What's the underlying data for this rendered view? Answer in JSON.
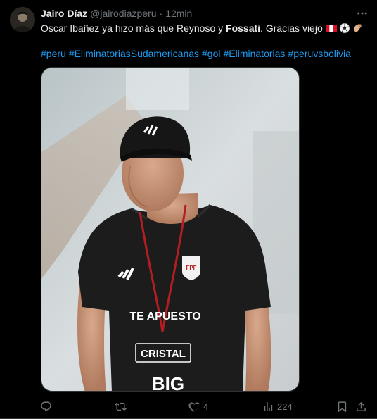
{
  "author": {
    "name": "Jairo Díaz",
    "handle": "@jairodiazperu",
    "separator": "·",
    "time": "12min"
  },
  "tweet": {
    "text_part1": "Oscar Ibañez ya hizo más que Reynoso y ",
    "text_bold": "Fossati",
    "text_part2": ". Gracias viejo",
    "emojis": [
      "peru-flag-icon",
      "soccer-ball-icon",
      "clapping-hands-icon"
    ],
    "hashtags": [
      "#peru",
      "#EliminatoriasSudamericanas",
      "#gol",
      "#Eliminatorias",
      "#peruvsbolivia"
    ]
  },
  "media": {
    "alt": "Coach in black training shirt with FPF crest",
    "logo_text": "FPF",
    "sponsor1": "TE APUESTO",
    "sponsor2": "CRISTAL",
    "sponsor3": "BIG"
  },
  "actions": {
    "reply_count": "",
    "retweet_count": "",
    "like_count": "4",
    "views_count": "224"
  }
}
